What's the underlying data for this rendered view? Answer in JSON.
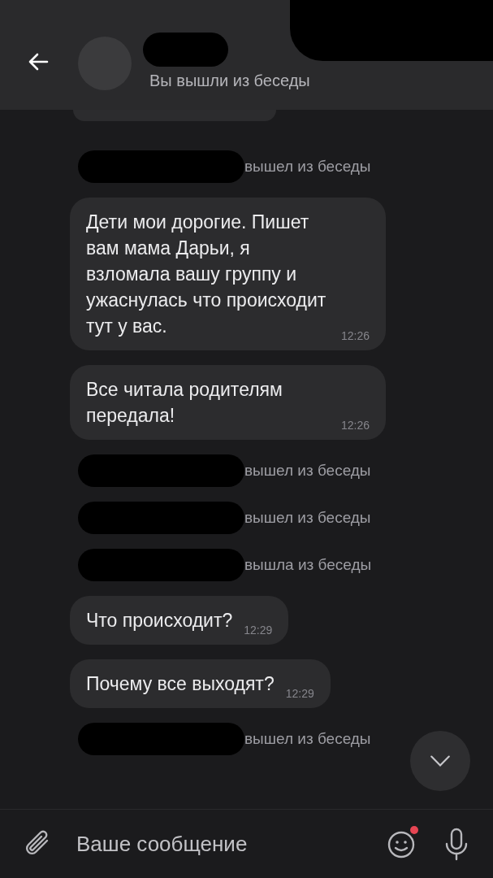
{
  "header": {
    "subtitle": "Вы вышли из беседы"
  },
  "messages": [
    {
      "kind": "service",
      "text": "вышел из беседы"
    },
    {
      "kind": "message",
      "text": "Дети мои дорогие. Пишет вам мама Дарьи, я взломала вашу группу и ужаснулась что происходит тут у вас.",
      "time": "12:26"
    },
    {
      "kind": "message",
      "text": "Все читала родителям передала!",
      "time": "12:26"
    },
    {
      "kind": "service",
      "text": "вышел из беседы"
    },
    {
      "kind": "service",
      "text": "вышел из беседы"
    },
    {
      "kind": "service",
      "text": "вышла из беседы"
    },
    {
      "kind": "message",
      "text": "Что происходит?",
      "time": "12:29"
    },
    {
      "kind": "message",
      "text": "Почему все выходят?",
      "time": "12:29"
    },
    {
      "kind": "service",
      "text": "вышел из беседы"
    }
  ],
  "composer": {
    "placeholder": "Ваше сообщение",
    "emoji_badge": true
  }
}
